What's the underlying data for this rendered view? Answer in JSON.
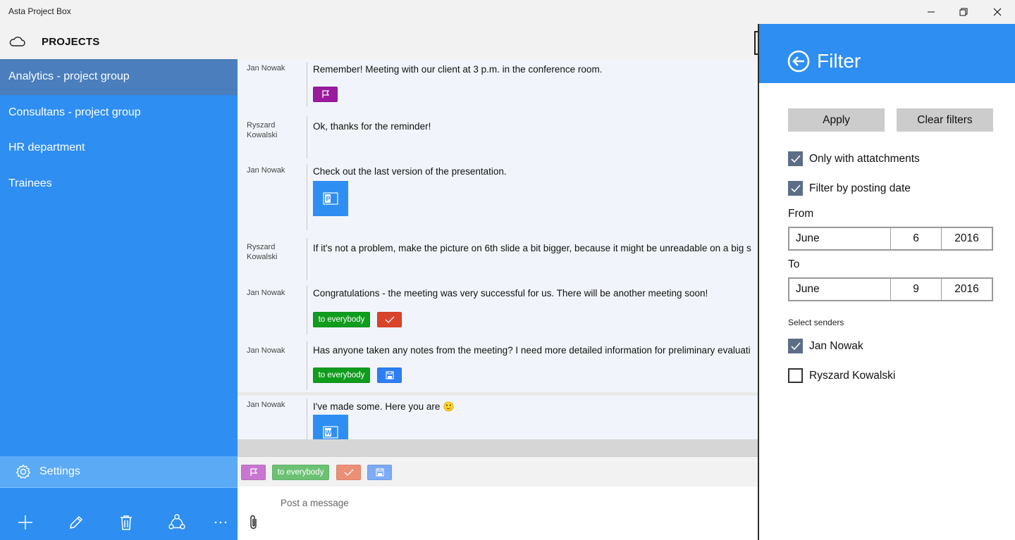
{
  "window": {
    "title": "Asta Project Box"
  },
  "header": {
    "label": "PROJECTS"
  },
  "sidebar": {
    "items": [
      {
        "label": "Analytics - project group"
      },
      {
        "label": "Consultans - project group"
      },
      {
        "label": "HR department"
      },
      {
        "label": "Trainees"
      }
    ],
    "settings_label": "Settings"
  },
  "messages": [
    {
      "sender": "Jan Nowak",
      "text": "Remember! Meeting with our client at 3 p.m. in the conference room."
    },
    {
      "sender": "Ryszard Kowalski",
      "text": "Ok, thanks for the reminder!"
    },
    {
      "sender": "Jan Nowak",
      "text": "Check out the last version of the presentation."
    },
    {
      "sender": "Ryszard Kowalski",
      "text": "If it's not a problem, make the picture on 6th slide a bit bigger, because it might be unreadable on a big s"
    },
    {
      "sender": "Jan Nowak",
      "text": "Congratulations - the meeting was very successful for us. There will be another meeting soon!"
    },
    {
      "sender": "Jan Nowak",
      "text": "Has anyone taken any notes from the meeting? I need more detailed information for preliminary evaluati"
    },
    {
      "sender": "Jan Nowak",
      "text": "I've made some. Here you are 🙂"
    }
  ],
  "tags": {
    "to_everybody": "to everybody"
  },
  "compose": {
    "placeholder": "Post a message"
  },
  "filter": {
    "title": "Filter",
    "apply": "Apply",
    "clear": "Clear filters",
    "only_attachments": "Only with attatchments",
    "by_date": "Filter by posting date",
    "from_label": "From",
    "from": {
      "month": "June",
      "day": "6",
      "year": "2016"
    },
    "to_label": "To",
    "to": {
      "month": "June",
      "day": "9",
      "year": "2016"
    },
    "senders_label": "Select senders",
    "senders": [
      {
        "name": "Jan Nowak",
        "checked": true
      },
      {
        "name": "Ryszard Kowalski",
        "checked": false
      }
    ]
  },
  "colors": {
    "accent": "#2e8ef2",
    "sidebar_active": "#4a7ebd",
    "tag_flag": "#9b1b9e",
    "tag_everybody": "#109c1d",
    "tag_check": "#d9442b",
    "tag_save": "#2e7ef2"
  }
}
